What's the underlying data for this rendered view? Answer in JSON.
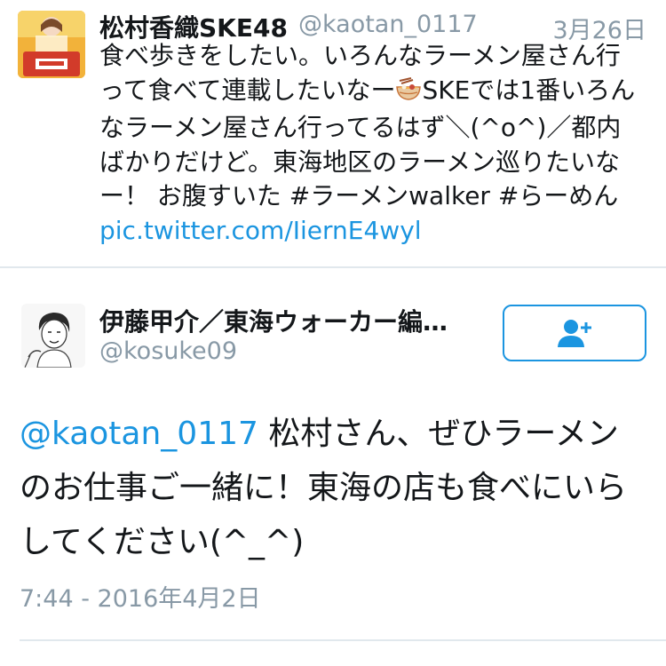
{
  "parent_tweet": {
    "author_name": "松村香織SKE48",
    "handle": "@kaotan_0117",
    "date": "3月26日",
    "text_part1": "食べ歩きをしたい。いろんなラーメン屋さん行って食べて連載したいなー",
    "ramen_emoji": "ramen-bowl-icon",
    "text_part2": "SKEでは1番いろんなラーメン屋さん行ってるはず＼(^o^)／都内ばかりだけど。東海地区のラーメン巡りたいなー！ お腹すいた #ラーメンwalker #らーめん ",
    "link": "pic.twitter.com/IiernE4wyl"
  },
  "reply_tweet": {
    "author_name": "伊藤甲介／東海ウォーカー編集長",
    "handle": "@kosuke09",
    "mention": "@kaotan_0117",
    "text": " 松村さん、ぜひラーメンのお仕事ご一緒に！東海の店も食べにいらしてください(^_^)",
    "timestamp": "7:44 - 2016年4月2日",
    "follow_icon": "add-user-icon"
  },
  "colors": {
    "link": "#1b95e0",
    "muted": "#8899a6",
    "divider": "#e1e8ed",
    "text": "#14171a"
  }
}
